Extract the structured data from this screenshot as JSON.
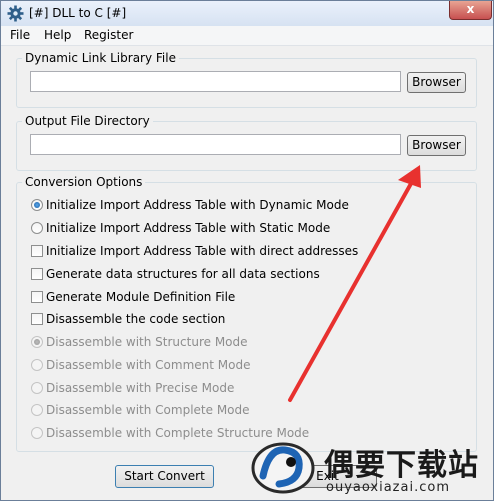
{
  "window": {
    "title": "[#] DLL to C [#]",
    "close_glyph": "x"
  },
  "menu": [
    {
      "label": "File"
    },
    {
      "label": "Help"
    },
    {
      "label": "Register"
    }
  ],
  "dll_group": {
    "label": "Dynamic Link Library File",
    "value": "",
    "browse_label": "Browser"
  },
  "output_group": {
    "label": "Output File Directory",
    "value": "",
    "browse_label": "Browser"
  },
  "options_group": {
    "label": "Conversion Options",
    "items": [
      {
        "label": "Initialize Import Address Table with Dynamic Mode",
        "kind": "radio",
        "checked": true,
        "enabled": true
      },
      {
        "label": "Initialize Import Address Table with Static Mode",
        "kind": "radio",
        "checked": false,
        "enabled": true
      },
      {
        "label": "Initialize Import Address Table with direct addresses",
        "kind": "checkbox",
        "checked": false,
        "enabled": true
      },
      {
        "label": "Generate data structures for all data sections",
        "kind": "checkbox",
        "checked": false,
        "enabled": true
      },
      {
        "label": "Generate Module Definition File",
        "kind": "checkbox",
        "checked": false,
        "enabled": true
      },
      {
        "label": "Disassemble the code section",
        "kind": "checkbox",
        "checked": false,
        "enabled": true
      },
      {
        "label": "Disassemble with Structure Mode",
        "kind": "radio",
        "checked": true,
        "enabled": false
      },
      {
        "label": "Disassemble with Comment Mode",
        "kind": "radio",
        "checked": false,
        "enabled": false
      },
      {
        "label": "Disassemble with Precise Mode",
        "kind": "radio",
        "checked": false,
        "enabled": false
      },
      {
        "label": "Disassemble with Complete Mode",
        "kind": "radio",
        "checked": false,
        "enabled": false
      },
      {
        "label": "Disassemble with Complete Structure Mode",
        "kind": "radio",
        "checked": false,
        "enabled": false
      }
    ]
  },
  "footer": {
    "start_label": "Start Convert",
    "exit_label": "Exit"
  },
  "annotation": {
    "arrow_color": "#e8312f"
  },
  "watermark": {
    "brand_text": "偶要下载站",
    "url": "ouyaoxiazai.com"
  }
}
